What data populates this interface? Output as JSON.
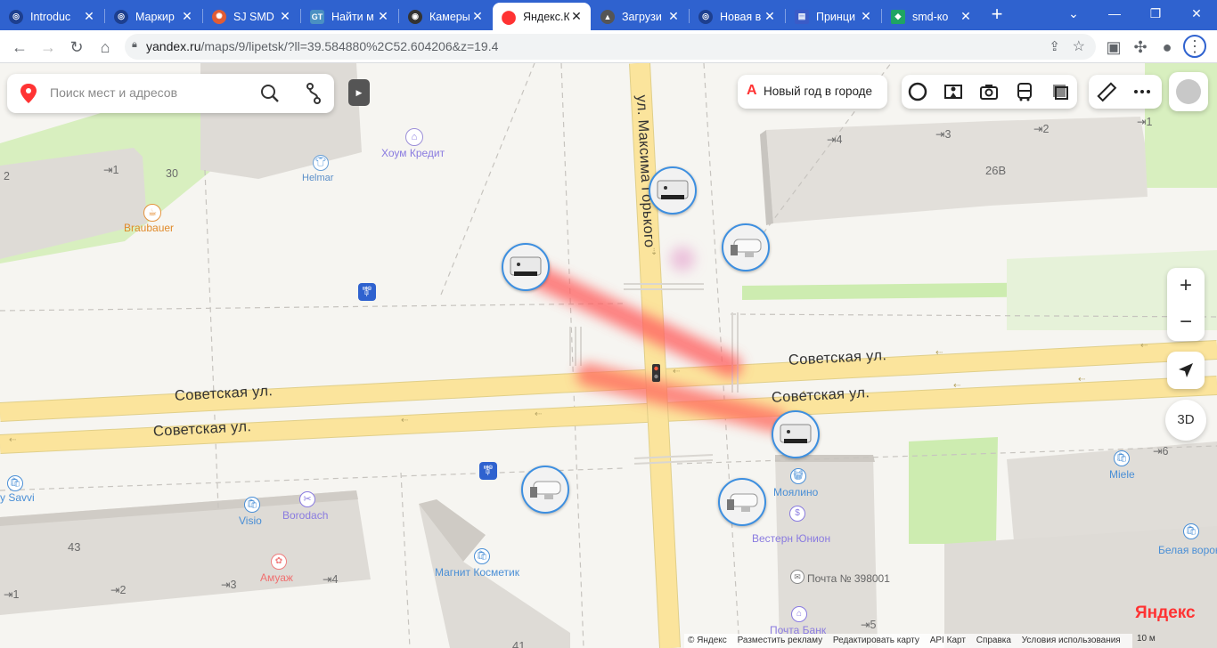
{
  "browser": {
    "tabs": [
      {
        "title": "Introduc",
        "favicon_color": "#5f6368",
        "active": false
      },
      {
        "title": "Маркир",
        "favicon_color": "#5f6368",
        "active": false
      },
      {
        "title": "SJ SMD",
        "favicon_color": "#e05c35",
        "active": false
      },
      {
        "title": "Найти м",
        "favicon_color": "#4a90c2",
        "favicon_text": "GT",
        "active": false
      },
      {
        "title": "Камеры",
        "favicon_color": "#333333",
        "active": false
      },
      {
        "title": "Яндекс.К",
        "favicon_color": "#f33333",
        "active": true
      },
      {
        "title": "Загрузи",
        "favicon_color": "#555555",
        "active": false
      },
      {
        "title": "Новая в",
        "favicon_color": "#5f6368",
        "active": false
      },
      {
        "title": "Принци",
        "favicon_color": "#3a5bc7",
        "active": false
      },
      {
        "title": "smd-ко",
        "favicon_color": "#1fa463",
        "active": false
      }
    ],
    "new_tab": "+",
    "url_host": "yandex.ru",
    "url_path": "/maps/9/lipetsk/?ll=39.584880%2C52.604206&z=19.4",
    "accent": "#2f62cf"
  },
  "map": {
    "search_placeholder": "Поиск мест и адресов",
    "promo_icon": "А",
    "promo_label": "Новый год в городе",
    "zoom_in": "+",
    "zoom_out": "−",
    "btn_3d": "3D",
    "streets": {
      "sovetskaya_1": "Советская ул.",
      "sovetskaya_2": "Советская ул.",
      "sovetskaya_3": "Советская ул.",
      "sovetskaya_4": "Советская ул.",
      "gorkogo": "ул. Максима Горького"
    },
    "buildings": {
      "b30": "30",
      "b26v": "26В",
      "b43": "43",
      "b41": "41",
      "e4": "4",
      "e3": "3",
      "e2": "2",
      "e1": "1",
      "w1": "1",
      "w2": "2",
      "s1": "1",
      "s2": "2",
      "s3": "3",
      "s4": "4",
      "e5": "5",
      "e6": "6"
    },
    "pois": {
      "home_credit": "Хоум Кредит",
      "helmar": "Helmar",
      "braubauer": "Braubauer",
      "savvi": "y Savvi",
      "visio": "Visio",
      "borodach": "Borodach",
      "amuazh": "Амуаж",
      "magnit": "Магнит Косметик",
      "moyalino": "Моялино",
      "western_union": "Вестерн Юнион",
      "pochta": "Почта № 398001",
      "pochta_bank": "Почта Банк",
      "miele": "Miele",
      "belaya": "Белая ворона"
    },
    "logo_main": "Яндекс",
    "copyright": [
      "© Яндекс",
      "Разместить рекламу",
      "Редактировать карту",
      "API Карт",
      "Справка",
      "Условия использования"
    ],
    "scale_label": "10 м",
    "colors": {
      "road": "#fbe49c",
      "building": "#e4e1dc",
      "green": "#d8efbf",
      "camera_ring": "#3d8fe0",
      "heat": "#ff5f5f"
    }
  }
}
